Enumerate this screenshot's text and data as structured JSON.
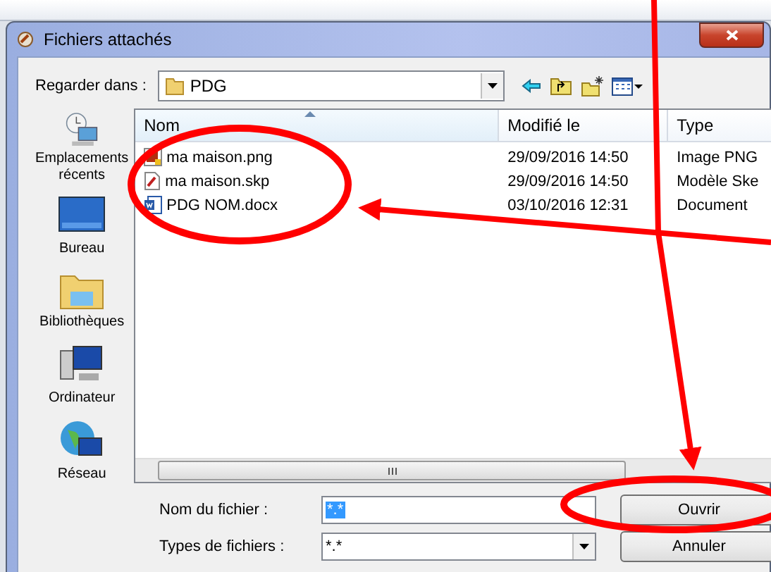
{
  "window": {
    "title": "Fichiers attachés"
  },
  "look_in": {
    "label": "Regarder dans :",
    "value": "PDG"
  },
  "places": [
    {
      "label": "Emplacements récents",
      "kind": "recent"
    },
    {
      "label": "Bureau",
      "kind": "desktop"
    },
    {
      "label": "Bibliothèques",
      "kind": "libraries"
    },
    {
      "label": "Ordinateur",
      "kind": "computer"
    },
    {
      "label": "Réseau",
      "kind": "network"
    }
  ],
  "columns": [
    {
      "label": "Nom",
      "sorted": true
    },
    {
      "label": "Modifié le",
      "sorted": false
    },
    {
      "label": "Type",
      "sorted": false
    }
  ],
  "files": [
    {
      "name": "ma maison.png",
      "modified": "29/09/2016 14:50",
      "type": "Image PNG",
      "kind": "image"
    },
    {
      "name": "ma maison.skp",
      "modified": "29/09/2016 14:50",
      "type": "Modèle Ske",
      "kind": "model"
    },
    {
      "name": "PDG NOM.docx",
      "modified": "03/10/2016 12:31",
      "type": "Document",
      "kind": "doc"
    }
  ],
  "file_name": {
    "label": "Nom du fichier :",
    "value": "*.*",
    "highlighted": true
  },
  "file_type": {
    "label": "Types de fichiers :",
    "value": "*.*"
  },
  "buttons": [
    {
      "label": "Ouvrir"
    },
    {
      "label": "Annuler"
    }
  ]
}
